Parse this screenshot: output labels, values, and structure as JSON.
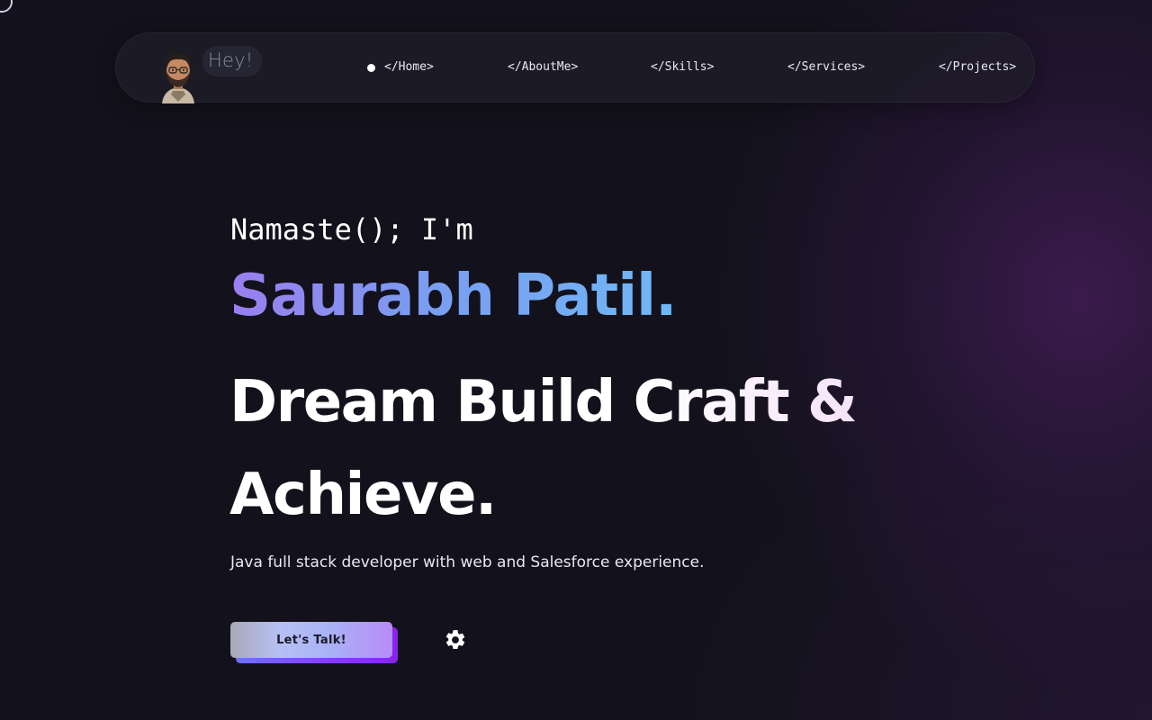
{
  "header": {
    "greeting_bubble": "Hey!",
    "nav": [
      {
        "label": "</Home>",
        "active": true
      },
      {
        "label": "</AboutMe>",
        "active": false
      },
      {
        "label": "</Skills>",
        "active": false
      },
      {
        "label": "</Services>",
        "active": false
      },
      {
        "label": "</Projects>",
        "active": false
      }
    ]
  },
  "hero": {
    "greeting": "Namaste(); I'm",
    "name": "Saurabh Patil.",
    "tagline": "Dream Build Craft & Achieve.",
    "subtitle": "Java full stack developer with web and Salesforce experience.",
    "cta_label": "Let's Talk!"
  },
  "icons": {
    "settings": "gear-icon",
    "avatar": "avatar-icon"
  },
  "colors": {
    "background": "#13121c",
    "name_gradient_start": "#9a7ef0",
    "name_gradient_end": "#6fb8f6",
    "cta_shadow": "#8a3cf2"
  }
}
